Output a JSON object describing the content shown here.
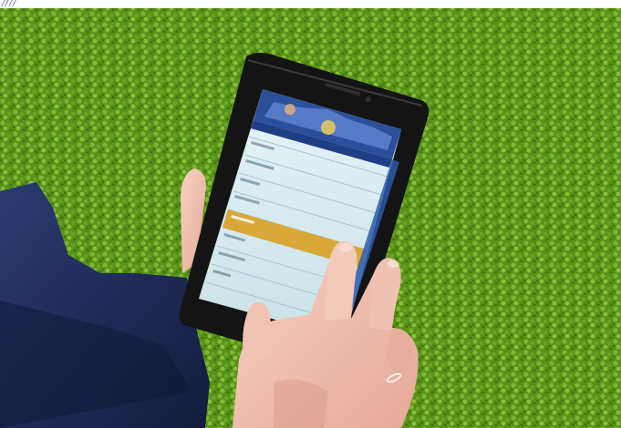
{
  "corner_mark": "////",
  "colors": {
    "grass_dark": "#3f7a12",
    "grass_mid": "#5e9d1c",
    "grass_light": "#8cc63a",
    "sleeve": "#1f2a55",
    "sleeve_shadow": "#121936",
    "tablet_body": "#141414",
    "screen_bg": "#dceef2",
    "screen_highlight": "#d9a73a",
    "skin": "#f1c3b4",
    "skin_shadow": "#d99a88"
  },
  "tablet": {
    "list_rows": 9,
    "highlighted_row": 5
  }
}
